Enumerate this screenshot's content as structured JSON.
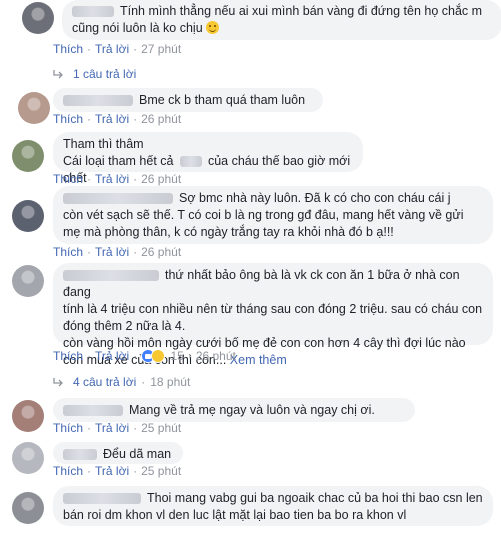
{
  "labels": {
    "like": "Thích",
    "reply": "Trả lời",
    "sep": "·"
  },
  "colors": {
    "link": "#4267b2",
    "meta": "#90949c",
    "bubble": "#f2f3f5"
  },
  "comments": [
    {
      "text": "Tính mình thẳng nếu ai xui mình bán vàng đi đứng tên họ chắc m cũng nói luôn là ko chịu",
      "emoji": "smile-emoji",
      "time": "27 phút"
    },
    {
      "reply_count": "1 câu trả lời"
    },
    {
      "text": "Bme ck b tham quá tham luôn",
      "time": "26 phút"
    },
    {
      "name": "Tham thì thâm",
      "text_a": "Cái loại tham hết cả",
      "text_b": "của cháu thế bao giờ mới chết",
      "time": "26 phút"
    },
    {
      "text_first": "Sợ bmc nhà này luôn. Đã k có cho con cháu cái j",
      "text_rest": "còn vét sạch sẽ thế. T có coi b là ng trong gđ đâu, mang hết vàng về gửi mẹ mà phòng thân, k có ngày trắng tay ra khỏi nhà đó b ạ!!!",
      "time": "26 phút"
    },
    {
      "text_first": "thứ nhất bảo ông bà là vk ck con ăn 1 bữa ở nhà con đang",
      "text_rest": "tính là 4 triệu con nhiều nên từ tháng sau con đóng 2 triệu. sau có cháu con đóng thêm 2 nữa là 4.",
      "text_more": "còn vàng hồi môn ngày cưới bố mẹ đẻ con con hơn 4 cây thì đợi lúc nào con mua xe của con thì con...",
      "see_more": "Xem thêm",
      "reaction_count": "15",
      "time": "26 phút"
    },
    {
      "reply_count": "4 câu trả lời",
      "time": "18 phút"
    },
    {
      "text": "Mang về trả mẹ ngay và luôn và ngay chị ơi.",
      "time": "25 phút"
    },
    {
      "text": "Đểu dã man",
      "time": "25 phút"
    },
    {
      "text_first": "Thoi mang vabg gui ba ngoaik chac củ ba hoi thi bao csn len",
      "text_rest": "bán roi dm khon vl den luc lật mặt lại bao tien ba bo ra khon vl"
    }
  ]
}
